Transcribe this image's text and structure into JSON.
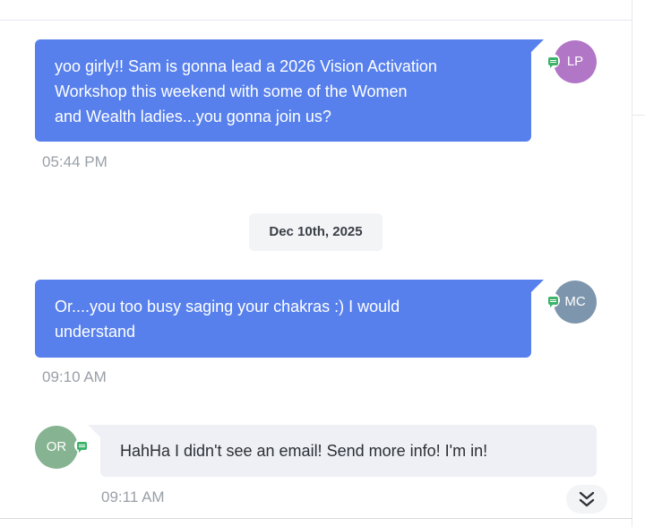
{
  "messages": [
    {
      "direction": "outgoing",
      "text": "yoo girly!! Sam is gonna lead a 2026 Vision Activation\nWorkshop this weekend with some of the Women\nand Wealth ladies...you gonna join us?",
      "time": "05:44 PM",
      "avatar": {
        "initials": "LP",
        "color": "#b276c7"
      },
      "channel_icon": "sms-chat-icon"
    },
    {
      "direction": "outgoing",
      "text": "Or....you too busy saging your chakras :) I would\nunderstand",
      "time": "09:10 AM",
      "avatar": {
        "initials": "MC",
        "color": "#7d96ad"
      },
      "channel_icon": "sms-chat-icon"
    },
    {
      "direction": "incoming",
      "text": "HahHa I didn't see an email! Send more info! I'm in!",
      "time": "09:11 AM",
      "avatar": {
        "initials": "OR",
        "color": "#86b391"
      },
      "channel_icon": "sms-chat-icon"
    }
  ],
  "date_separator": "Dec 10th, 2025",
  "scroll_button_icon": "double-chevron-down-icon",
  "colors": {
    "outgoing_bubble": "#5780ec",
    "incoming_bubble": "#eef0f5",
    "channel_icon": "#3db36a"
  }
}
